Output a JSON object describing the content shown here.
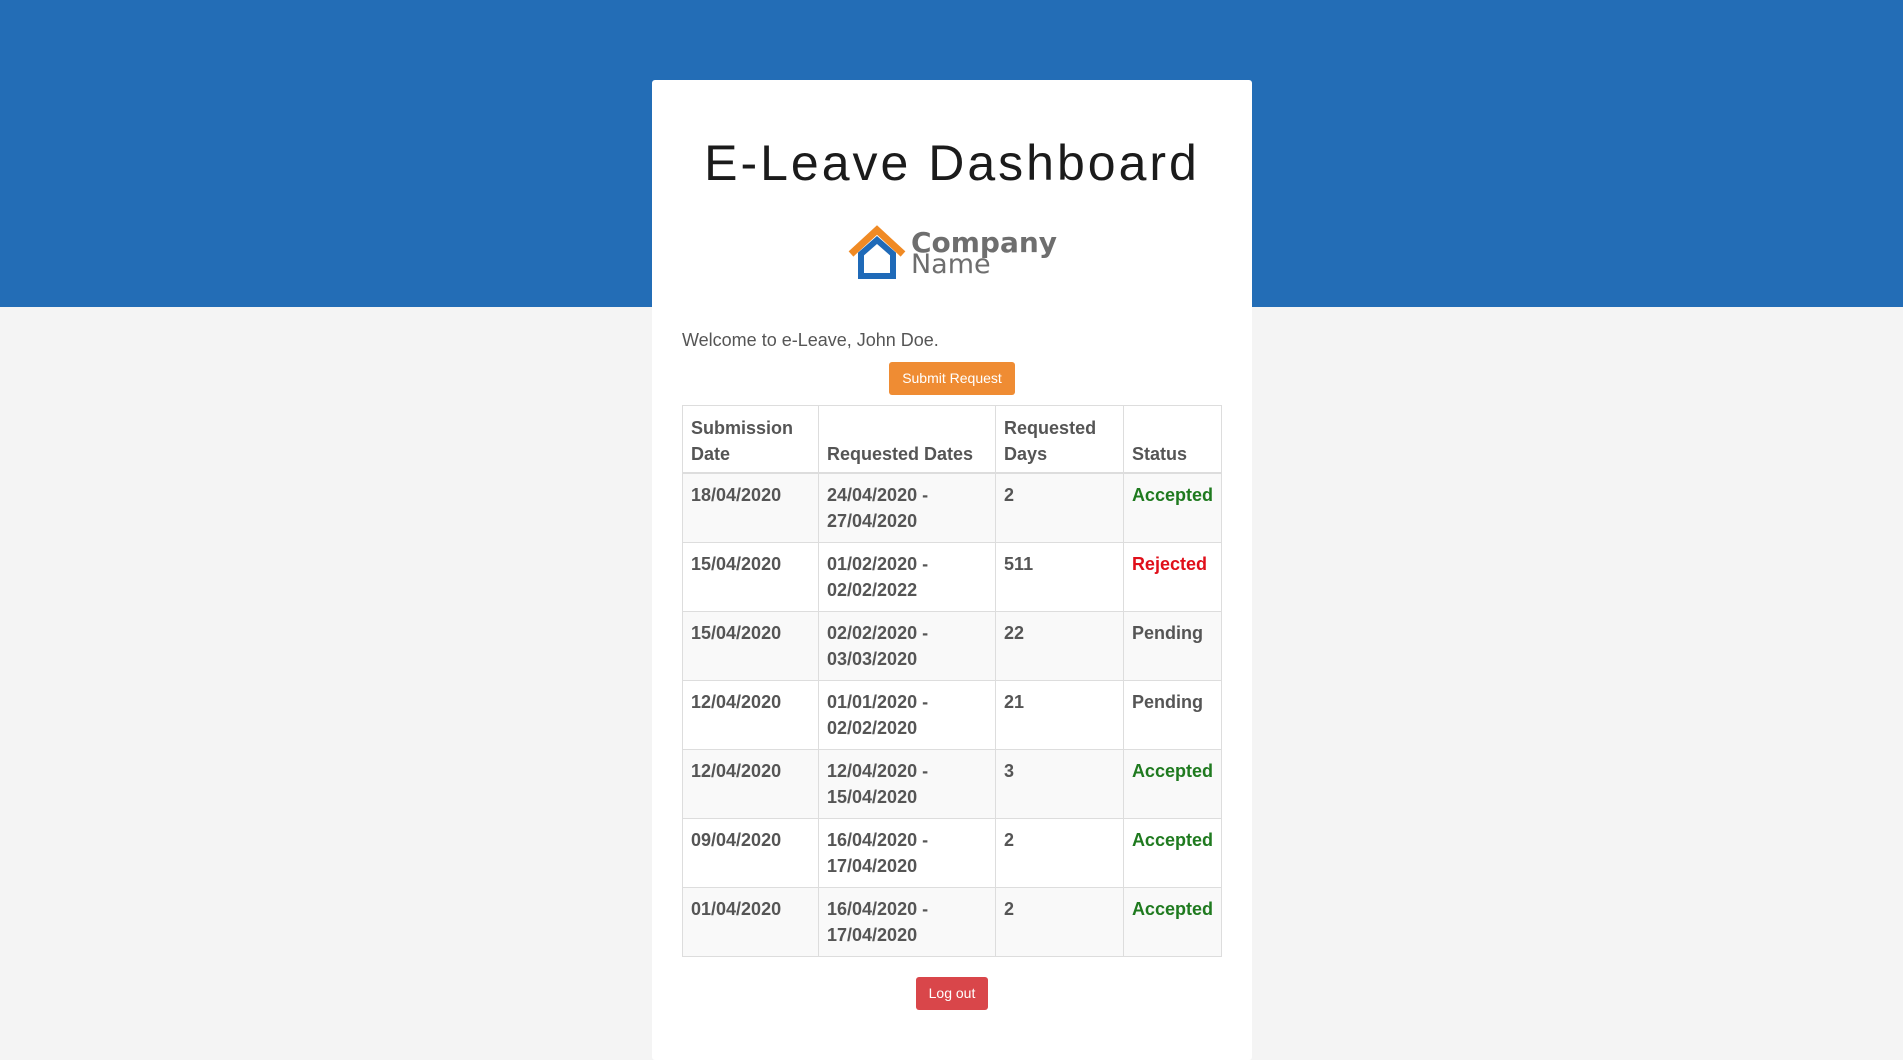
{
  "page": {
    "title": "E-Leave Dashboard",
    "logo": {
      "line1": "Company",
      "line2": "Name"
    },
    "welcome": "Welcome to e-Leave, John Doe."
  },
  "actions": {
    "submit_label": "Submit Request",
    "logout_label": "Log out"
  },
  "table": {
    "headers": {
      "submission": "Submission Date",
      "dates": "Requested Dates",
      "days": "Requested Days",
      "status": "Status"
    },
    "rows": [
      {
        "submission": "18/04/2020",
        "dates": "24/04/2020 - 27/04/2020",
        "days": "2",
        "status": "Accepted"
      },
      {
        "submission": "15/04/2020",
        "dates": "01/02/2020 - 02/02/2022",
        "days": "511",
        "status": "Rejected"
      },
      {
        "submission": "15/04/2020",
        "dates": "02/02/2020 - 03/03/2020",
        "days": "22",
        "status": "Pending"
      },
      {
        "submission": "12/04/2020",
        "dates": "01/01/2020 - 02/02/2020",
        "days": "21",
        "status": "Pending"
      },
      {
        "submission": "12/04/2020",
        "dates": "12/04/2020 - 15/04/2020",
        "days": "3",
        "status": "Accepted"
      },
      {
        "submission": "09/04/2020",
        "dates": "16/04/2020 - 17/04/2020",
        "days": "2",
        "status": "Accepted"
      },
      {
        "submission": "01/04/2020",
        "dates": "16/04/2020 - 17/04/2020",
        "days": "2",
        "status": "Accepted"
      }
    ]
  },
  "colors": {
    "header_band": "#236db6",
    "submit_button": "#ef8c33",
    "logout_button": "#d9464a",
    "status_accepted": "#1f7a1f",
    "status_rejected": "#e00f1a",
    "status_pending": "#555555",
    "logo_roof": "#f08a24",
    "logo_house": "#1f6ab8"
  },
  "icons": {
    "logo": "house-logo-icon"
  }
}
